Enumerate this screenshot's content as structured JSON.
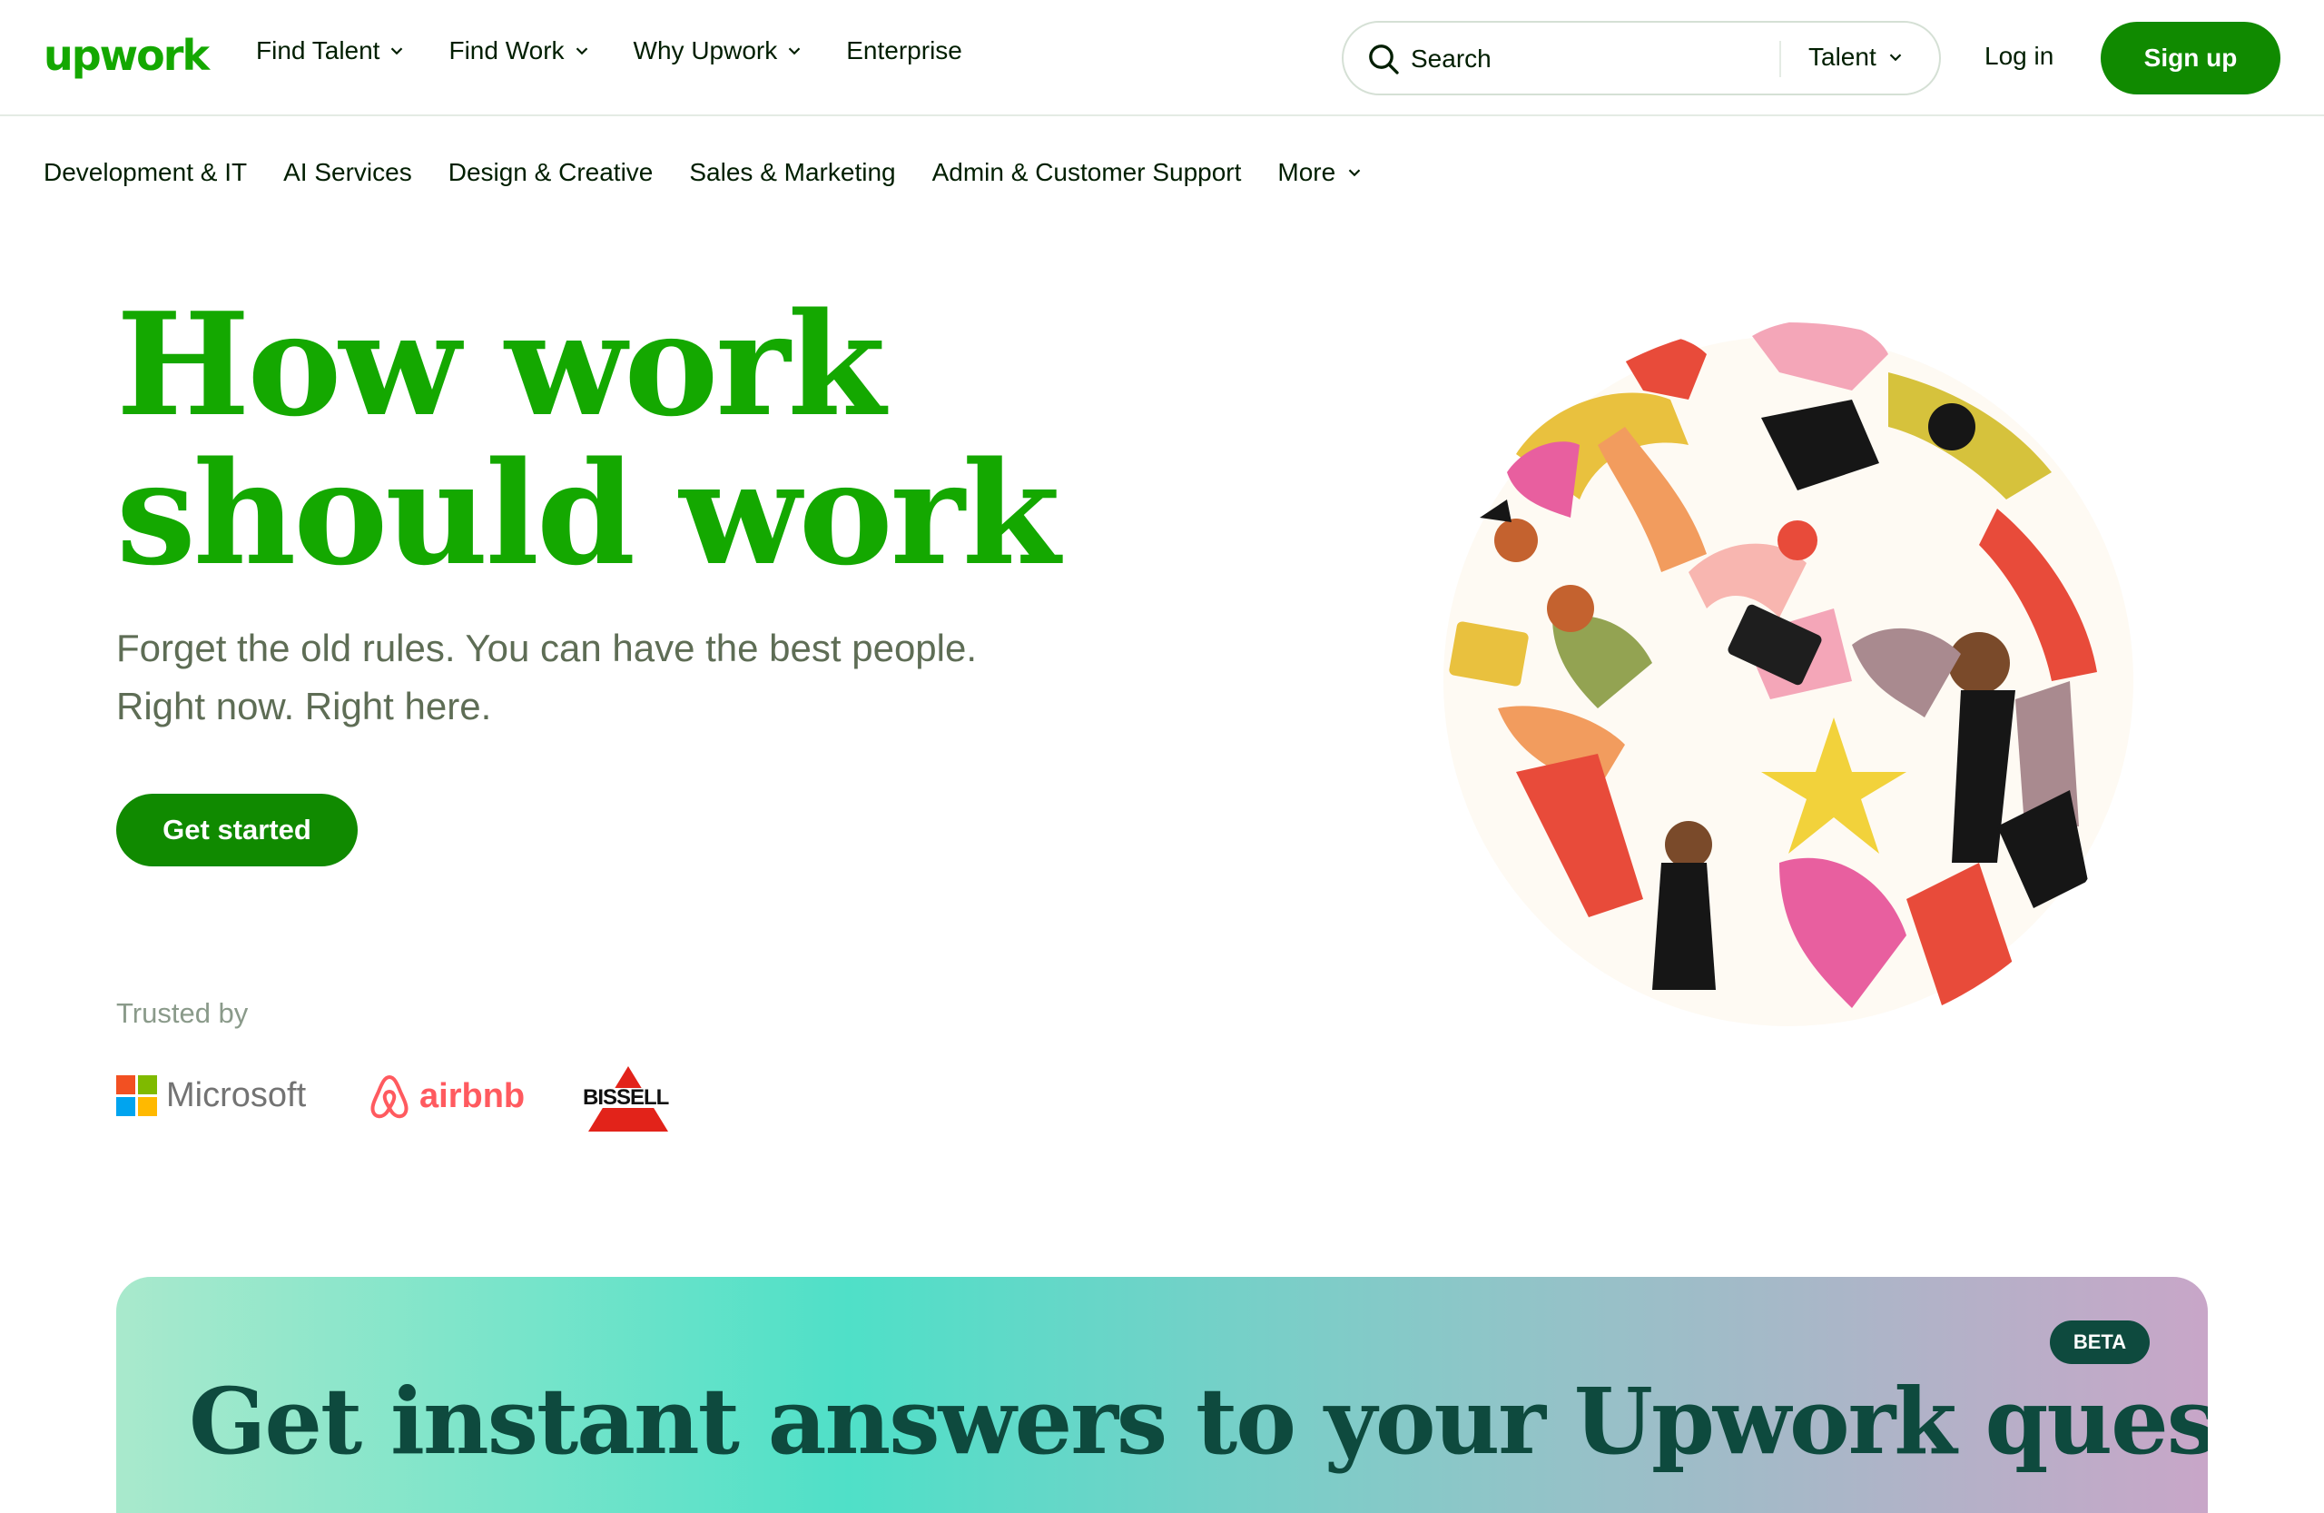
{
  "header": {
    "logo": "upwork",
    "nav": [
      {
        "label": "Find Talent",
        "dropdown": true
      },
      {
        "label": "Find Work",
        "dropdown": true
      },
      {
        "label": "Why Upwork",
        "dropdown": true
      },
      {
        "label": "Enterprise",
        "dropdown": false
      }
    ],
    "search": {
      "placeholder": "Search",
      "scope": "Talent"
    },
    "login": "Log in",
    "signup": "Sign up"
  },
  "categories": [
    "Development & IT",
    "AI Services",
    "Design & Creative",
    "Sales & Marketing",
    "Admin & Customer Support",
    "More"
  ],
  "hero": {
    "title_line1": "How work",
    "title_line2": "should work",
    "subtitle_line1": "Forget the old rules. You can have the best people.",
    "subtitle_line2": "Right now. Right here.",
    "cta": "Get started",
    "trusted_label": "Trusted by",
    "logos": {
      "microsoft": "Microsoft",
      "airbnb": "airbnb",
      "bissell": "BISSELL"
    }
  },
  "banner": {
    "badge": "BETA",
    "title": "Get instant answers to your Upwork questions"
  },
  "colors": {
    "brand_green": "#14a800",
    "button_green": "#108a00",
    "text_dark": "#001e00",
    "subtitle_gray": "#5e6d55"
  }
}
